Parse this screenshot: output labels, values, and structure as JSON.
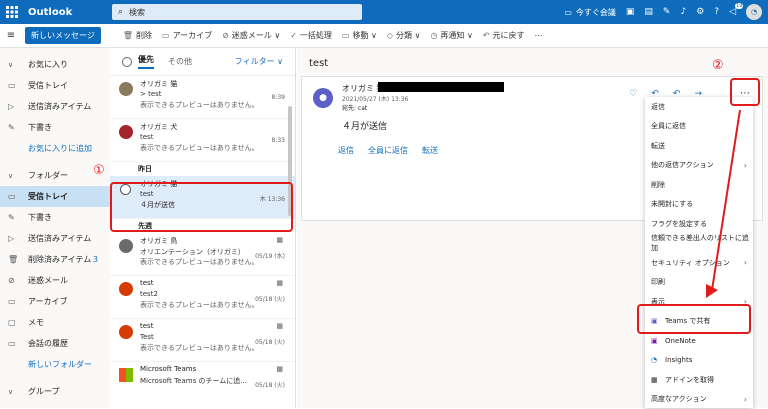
{
  "topbar": {
    "app_name": "Outlook",
    "search_placeholder": "検索",
    "meet_now": "今すぐ会議",
    "notif_count": "19"
  },
  "cmdbar": {
    "new_message": "新しいメッセージ",
    "commands": [
      "削除",
      "アーカイブ",
      "迷惑メール",
      "一括処理",
      "移動",
      "分類",
      "再通知",
      "元に戻す"
    ]
  },
  "sidebar": {
    "favorites": "お気に入り",
    "inbox": "受信トレイ",
    "sent": "送信済みアイテム",
    "drafts": "下書き",
    "add_favorite": "お気に入りに追加",
    "folders": "フォルダー",
    "inbox2": "受信トレイ",
    "drafts2": "下書き",
    "sent2": "送信済みアイテム",
    "deleted": "削除済みアイテム",
    "deleted_count": "3",
    "junk": "迷惑メール",
    "archive": "アーカイブ",
    "notes": "メモ",
    "history": "会話の履歴",
    "new_folder": "新しいフォルダー",
    "groups": "グループ"
  },
  "maillist": {
    "tab_focused": "優先",
    "tab_other": "その他",
    "filter": "フィルター",
    "group_yesterday": "昨日",
    "group_earlier": "先週",
    "mails": [
      {
        "from": "オリガミ 猫",
        "subject": "> test",
        "preview": "表示できるプレビューはありません。",
        "time": "8:39"
      },
      {
        "from": "オリガミ 犬",
        "subject": "test",
        "preview": "表示できるプレビューはありません。",
        "time": "8:33"
      },
      {
        "from": "オリガミ 猫",
        "subject": "test",
        "preview": "４月が送信",
        "time": "木 13:36"
      },
      {
        "from": "オリガミ 鳥",
        "subject": "オリエンテーション（オリガミ）",
        "preview": "表示できるプレビューはありません。",
        "time": "05/19 (水)"
      },
      {
        "from": "test",
        "subject": "test2",
        "preview": "表示できるプレビューはありません。",
        "time": "05/18 (火)"
      },
      {
        "from": "test",
        "subject": "Test",
        "preview": "表示できるプレビューはありません。",
        "time": "05/18 (火)"
      },
      {
        "from": "Microsoft Teams",
        "subject": "Microsoft Teams のチームに追...",
        "preview": "",
        "time": "05/18 (火)"
      }
    ]
  },
  "reading": {
    "title": "test",
    "from": "オリガミ 猫",
    "date": "2021/05/27 (木) 13:36",
    "to": "宛先:  cat",
    "body": "４月が送信",
    "reply": "返信",
    "reply_all": "全員に返信",
    "forward": "転送"
  },
  "menu": {
    "items": [
      "返信",
      "全員に返信",
      "転送",
      "他の返信アクション",
      "削除",
      "未開封にする",
      "フラグを設定する",
      "信頼できる差出人のリストに追加",
      "セキュリティ オプション",
      "印刷",
      "表示",
      "Teams で共有",
      "OneNote",
      "Insights",
      "アドインを取得",
      "高度なアクション"
    ]
  },
  "annotations": {
    "one": "①",
    "two": "②"
  },
  "colors": {
    "brand": "#0f6cbd",
    "highlight": "#e01b1b"
  }
}
